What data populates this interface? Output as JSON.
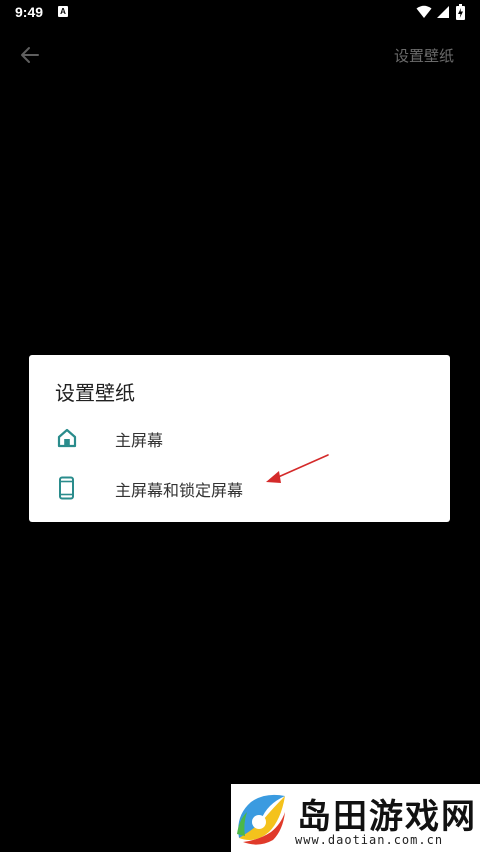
{
  "status_bar": {
    "time": "9:49",
    "app_icon_letter": "A",
    "icons": [
      "wifi-icon",
      "signal-icon",
      "battery-charging-icon"
    ]
  },
  "app_bar": {
    "back_icon": "arrow-left-icon",
    "action_label": "设置壁纸"
  },
  "dialog": {
    "title": "设置壁纸",
    "options": [
      {
        "icon": "home-icon",
        "label": "主屏幕"
      },
      {
        "icon": "phone-icon",
        "label": "主屏幕和锁定屏幕"
      }
    ],
    "accent_color": "#2a8c8c"
  },
  "annotation": {
    "color": "#d42a2a"
  },
  "watermark": {
    "brand": "岛田游戏网",
    "url": "www.daotian.com.cn"
  }
}
